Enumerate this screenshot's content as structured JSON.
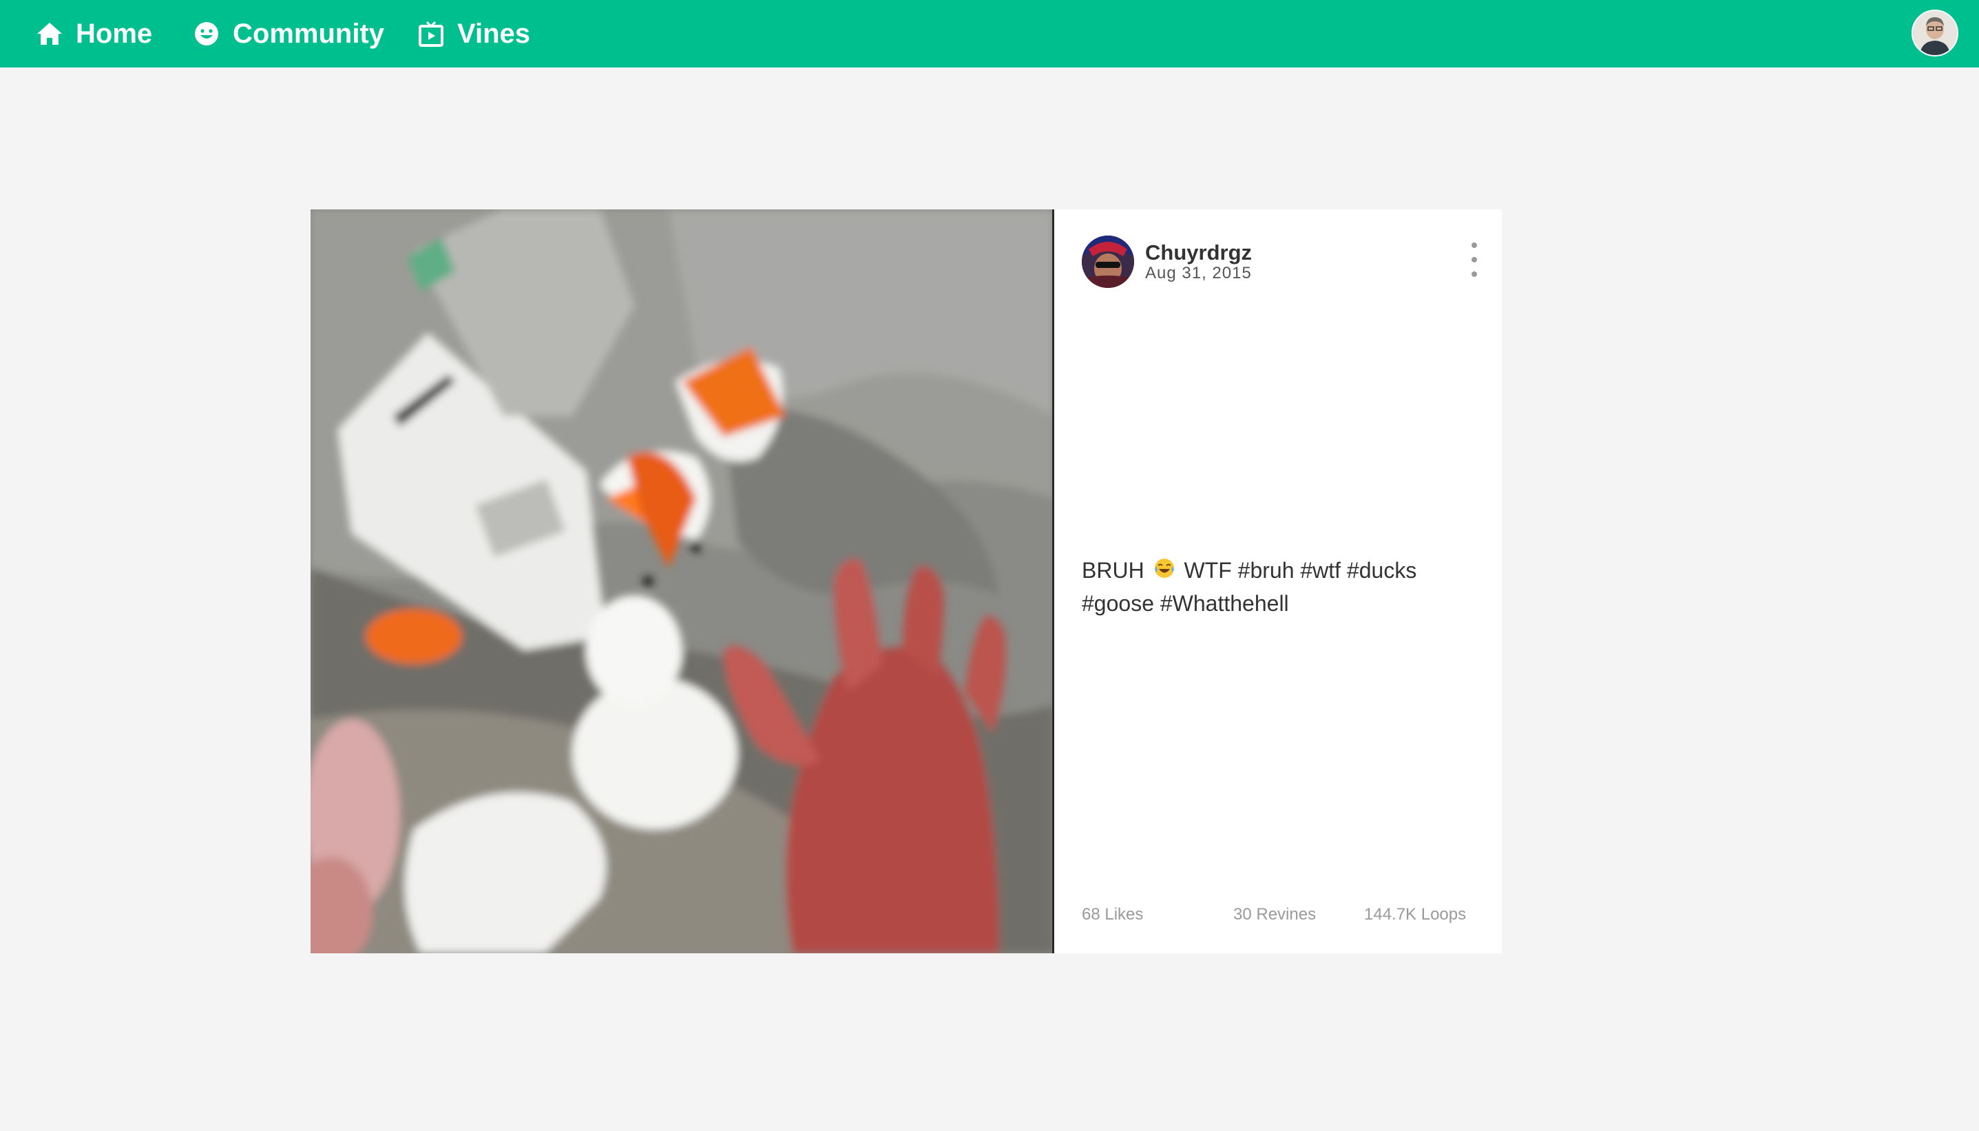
{
  "nav": {
    "items": [
      {
        "label": "Home",
        "icon": "home-icon"
      },
      {
        "label": "Community",
        "icon": "smiley-icon"
      },
      {
        "label": "Vines",
        "icon": "tv-play-icon"
      }
    ],
    "accent_color": "#00bf8f"
  },
  "post": {
    "author": "Chuyrdrgz",
    "date": "Aug 31, 2015",
    "caption_before_emoji": "BRUH",
    "caption_emoji": "face-with-tears-of-joy-icon",
    "caption_after_emoji": "WTF #bruh #wtf #ducks #goose #Whatthehell",
    "likes": "68 Likes",
    "revines": "30 Revines",
    "loops": "144.7K Loops"
  }
}
